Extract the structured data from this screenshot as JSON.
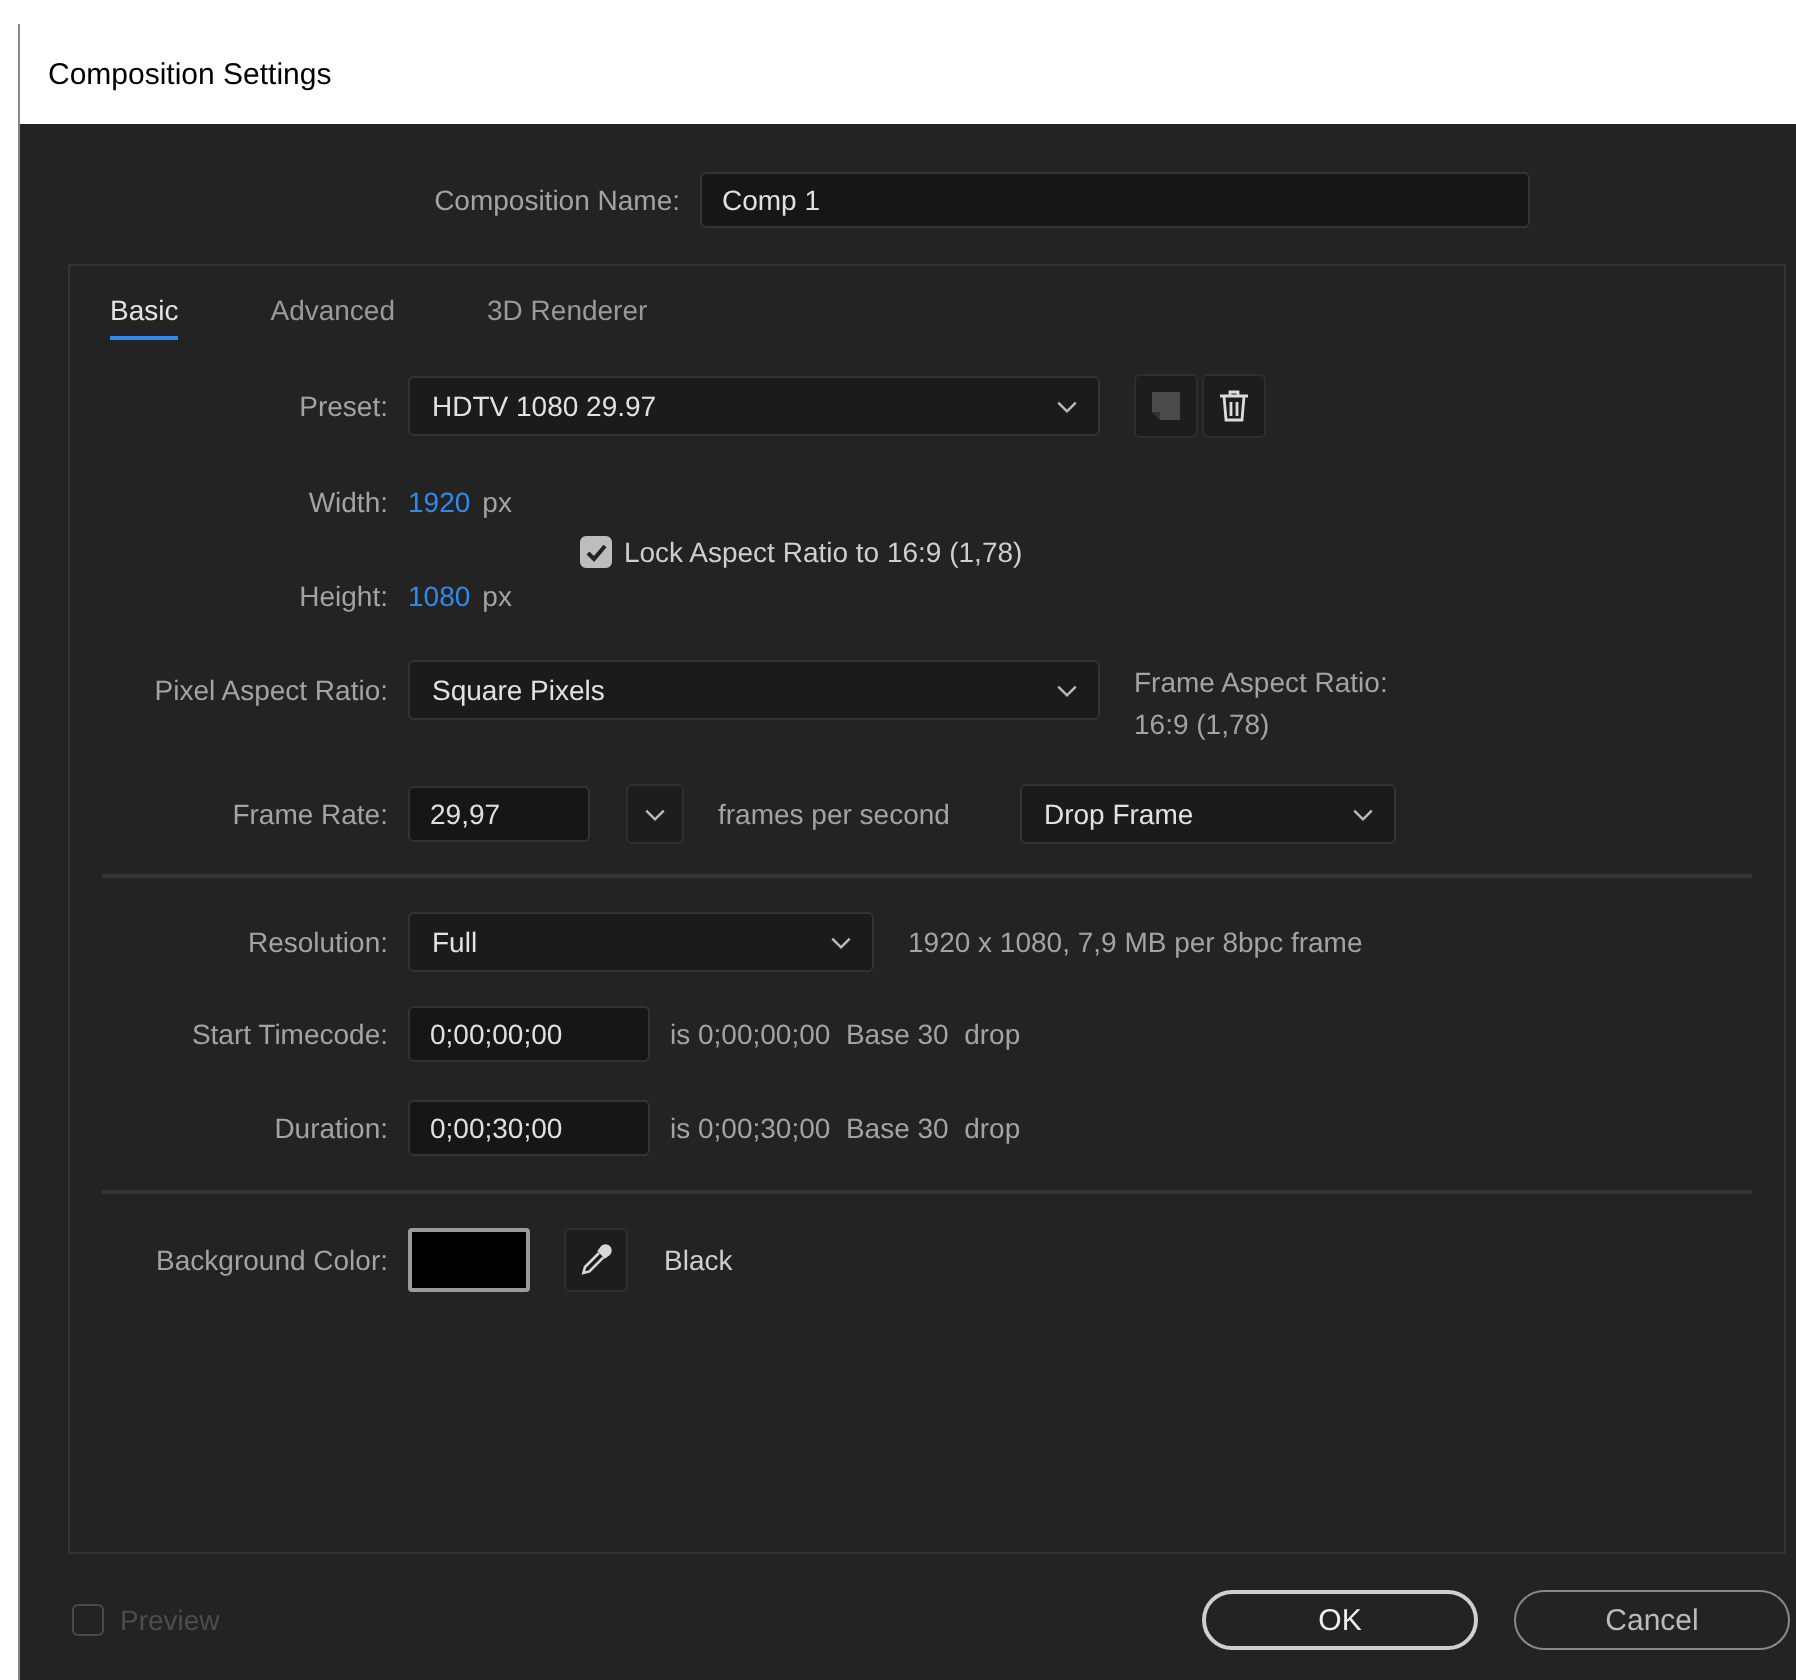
{
  "window": {
    "title": "Composition Settings"
  },
  "composition_name": {
    "label": "Composition Name:",
    "value": "Comp 1"
  },
  "tabs": [
    {
      "label": "Basic",
      "selected": true
    },
    {
      "label": "Advanced",
      "selected": false
    },
    {
      "label": "3D Renderer",
      "selected": false
    }
  ],
  "preset": {
    "label": "Preset:",
    "value": "HDTV 1080 29.97",
    "buttons": [
      {
        "kind": "save",
        "disabled": true
      },
      {
        "kind": "delete",
        "disabled": false
      }
    ]
  },
  "width": {
    "label": "Width:",
    "value": "1920",
    "unit": "px"
  },
  "height": {
    "label": "Height:",
    "value": "1080",
    "unit": "px"
  },
  "lock_aspect": {
    "label": "Lock Aspect Ratio to 16:9 (1,78)",
    "checked": true
  },
  "pixel_aspect": {
    "label": "Pixel Aspect Ratio:",
    "value": "Square Pixels"
  },
  "frame_aspect": {
    "label": "Frame Aspect Ratio:",
    "value": "16:9 (1,78)"
  },
  "frame_rate": {
    "label": "Frame Rate:",
    "value": "29,97",
    "unit": "frames per second",
    "drop": "Drop Frame"
  },
  "resolution": {
    "label": "Resolution:",
    "value": "Full",
    "info": "1920 x 1080, 7,9 MB per 8bpc frame"
  },
  "start_timecode": {
    "label": "Start Timecode:",
    "value": "0;00;00;00",
    "info": "is 0;00;00;00  Base 30  drop"
  },
  "duration": {
    "label": "Duration:",
    "value": "0;00;30;00",
    "info": "is 0;00;30;00  Base 30  drop"
  },
  "background_color": {
    "label": "Background Color:",
    "color": "#000000",
    "name": "Black"
  },
  "preview": {
    "label": "Preview",
    "checked": false,
    "disabled": true
  },
  "buttons": [
    {
      "label": "OK",
      "kind": "default"
    },
    {
      "label": "Cancel",
      "kind": "normal"
    }
  ]
}
